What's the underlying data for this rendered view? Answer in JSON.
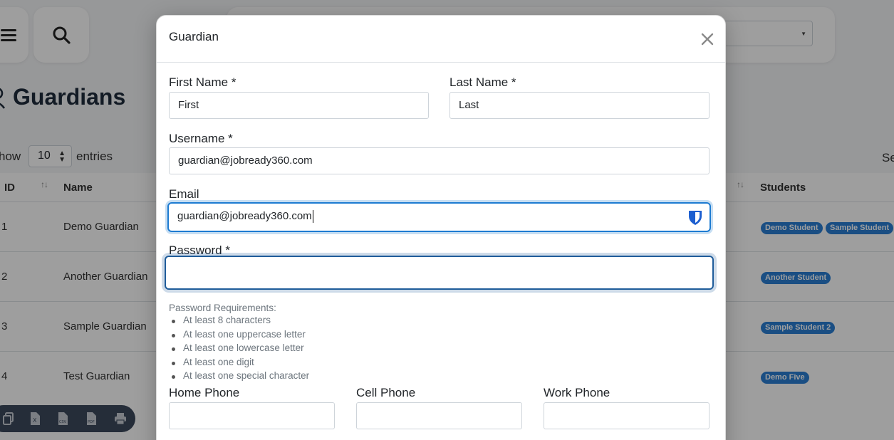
{
  "background": {
    "page_title": "Guardians",
    "show_label": "how",
    "entries_value": "10",
    "entries_label": "entries",
    "search_label": "Se",
    "table": {
      "headers": {
        "id": "ID",
        "name": "Name",
        "students": "Students"
      },
      "rows": [
        {
          "id": "1",
          "name": "Demo Guardian",
          "students": [
            "Demo Student",
            "Sample Student"
          ]
        },
        {
          "id": "2",
          "name": "Another Guardian",
          "students": [
            "Another Student"
          ]
        },
        {
          "id": "3",
          "name": "Sample Guardian",
          "students": [
            "Sample Student 2"
          ]
        },
        {
          "id": "4",
          "name": "Test Guardian",
          "students": [
            "Demo Five"
          ]
        }
      ]
    },
    "export_buttons": [
      "copy-icon",
      "excel-icon",
      "csv-icon",
      "pdf-icon",
      "print-icon"
    ]
  },
  "modal": {
    "title": "Guardian",
    "first_name": {
      "label": "First Name *",
      "value": "First"
    },
    "last_name": {
      "label": "Last Name *",
      "value": "Last"
    },
    "username": {
      "label": "Username *",
      "value": "guardian@jobready360.com"
    },
    "email": {
      "label": "Email",
      "value": "guardian@jobready360.com"
    },
    "password": {
      "label": "Password *",
      "value": ""
    },
    "password_requirements": {
      "title": "Password Requirements:",
      "items": [
        "At least 8 characters",
        "At least one uppercase letter",
        "At least one lowercase letter",
        "At least one digit",
        "At least one special character"
      ]
    },
    "home_phone": {
      "label": "Home Phone",
      "value": ""
    },
    "cell_phone": {
      "label": "Cell Phone",
      "value": ""
    },
    "work_phone": {
      "label": "Work Phone",
      "value": ""
    }
  },
  "colors": {
    "badge": "#2a7fd4",
    "focus_border": "#1d7bd1",
    "export_bar": "#3c4a5c"
  }
}
